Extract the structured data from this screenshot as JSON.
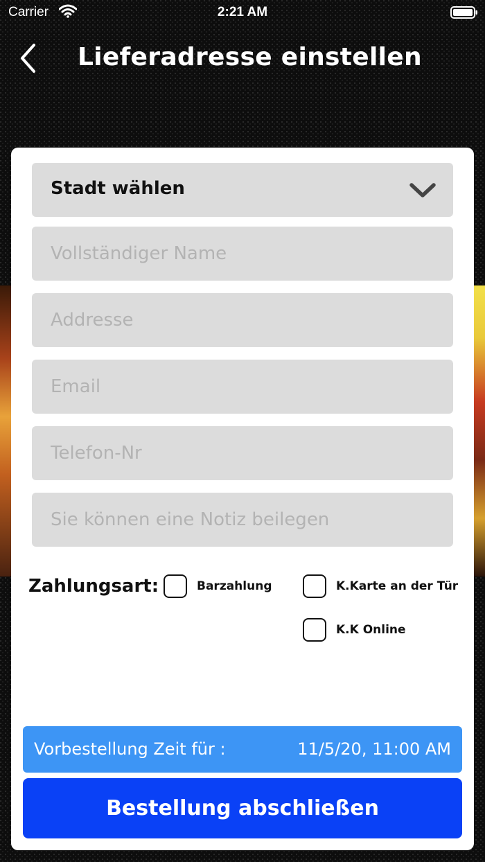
{
  "status_bar": {
    "carrier": "Carrier",
    "time": "2:21 AM"
  },
  "nav": {
    "title": "Lieferadresse einstellen",
    "back_icon": "chevron-left-icon"
  },
  "form": {
    "city_select": {
      "label": "Stadt wählen",
      "icon": "chevron-down-icon"
    },
    "name_placeholder": "Vollständiger Name",
    "address_placeholder": "Addresse",
    "email_placeholder": "Email",
    "phone_placeholder": "Telefon-Nr",
    "note_placeholder": "Sie können eine Notiz beilegen"
  },
  "payment": {
    "label": "Zahlungsart:",
    "options": [
      {
        "label": "Barzahlung",
        "checked": false
      },
      {
        "label": "K.Karte an der Tür",
        "checked": false
      },
      {
        "label": "K.K Online",
        "checked": false
      }
    ]
  },
  "preorder": {
    "label": "Vorbestellung Zeit für :",
    "value": "11/5/20, 11:00 AM"
  },
  "submit_label": "Bestellung abschließen",
  "colors": {
    "preorder_bar": "#3d95f5",
    "submit_button": "#0a41f6",
    "field_background": "#dcdcdc"
  }
}
